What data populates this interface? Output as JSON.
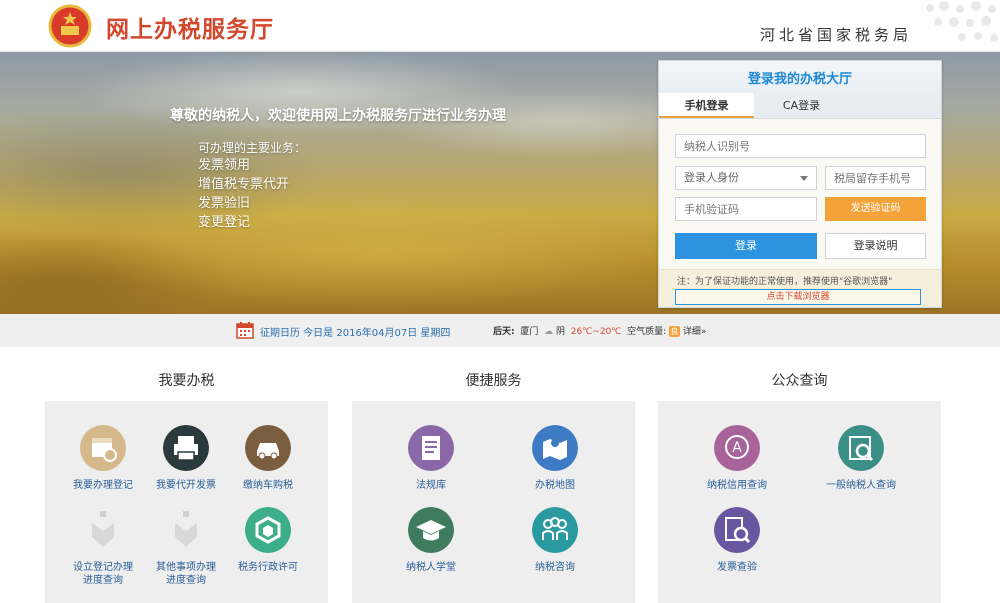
{
  "header": {
    "site_title": "网上办税服务厅",
    "bureau": "河北省国家税务局"
  },
  "banner": {
    "welcome": "尊敬的纳税人，欢迎使用网上办税服务厅进行业务办理",
    "biz_title": "可办理的主要业务：",
    "biz_items": [
      "发票领用",
      "增值税专票代开",
      "发票验旧",
      "变更登记"
    ]
  },
  "login": {
    "title": "登录我的办税大厅",
    "tabs": [
      "手机登录",
      "CA登录"
    ],
    "active_tab": "手机登录",
    "taxid_placeholder": "纳税人识别号",
    "role_select": "登录人身份",
    "phone_placeholder": "税局留存手机号",
    "code_placeholder": "手机验证码",
    "send_code": "发送验证码",
    "login_button": "登录",
    "help_button": "登录说明",
    "note": "注：为了保证功能的正常使用，推荐使用\"谷歌浏览器\"",
    "download": "点击下载浏览器"
  },
  "infobar": {
    "calendar": "征期日历 今日是 2016年04月07日 星期四",
    "weather_day": "后天:",
    "city": "厦门",
    "condition": "阴",
    "temp": "26℃~20℃",
    "aq_label": "空气质量:",
    "aq_value": "良",
    "detail": "详细»"
  },
  "sections": [
    {
      "title": "我要办税",
      "items": [
        {
          "label": "我要办理登记",
          "icon": "calendar-clock-icon",
          "color": "#d6b98a"
        },
        {
          "label": "我要代开发票",
          "icon": "printer-icon",
          "color": "#2a3a3c"
        },
        {
          "label": "缴纳车购税",
          "icon": "car-icon",
          "color": "#7b5e40"
        },
        {
          "label": "设立登记办理\n进度查询",
          "icon": "progress-ghost-icon",
          "color": "#cfcfcf"
        },
        {
          "label": "其他事项办理\n进度查询",
          "icon": "progress-ghost-icon",
          "color": "#cfcfcf"
        },
        {
          "label": "税务行政许可",
          "icon": "shield-icon",
          "color": "#3cae8a"
        }
      ]
    },
    {
      "title": "便捷服务",
      "items": [
        {
          "label": "法规库",
          "icon": "document-icon",
          "color": "#8a67a8"
        },
        {
          "label": "办税地图",
          "icon": "map-icon",
          "color": "#3f7ac4"
        },
        {
          "label": "纳税人学堂",
          "icon": "graduation-cap-icon",
          "color": "#3f7c5e"
        },
        {
          "label": "纳税咨询",
          "icon": "people-icon",
          "color": "#2a9aa0"
        }
      ]
    },
    {
      "title": "公众查询",
      "items": [
        {
          "label": "纳税信用查询",
          "icon": "credit-a-icon",
          "color": "#a8639a"
        },
        {
          "label": "一般纳税人查询",
          "icon": "search-doc-icon",
          "color": "#3c8f86"
        },
        {
          "label": "发票查验",
          "icon": "invoice-check-icon",
          "color": "#6a55a0"
        }
      ]
    }
  ]
}
